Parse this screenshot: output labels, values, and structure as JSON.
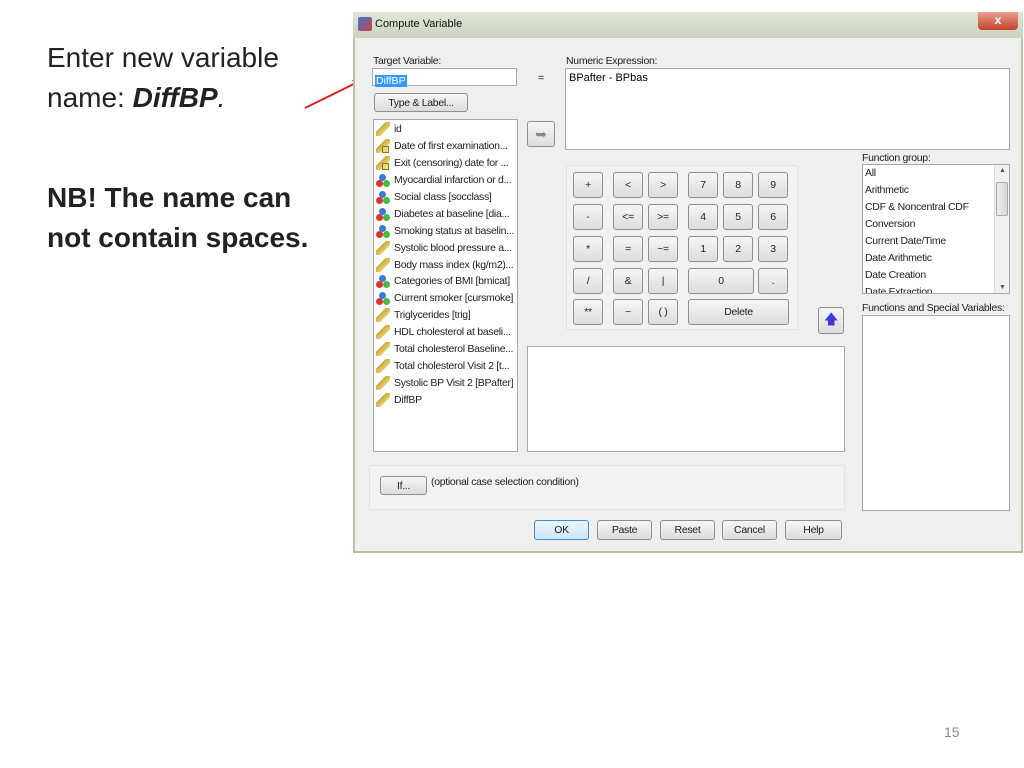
{
  "slide": {
    "line1": "Enter new variable",
    "line2_prefix": "name: ",
    "line2_name": "DiffBP",
    "line2_suffix": ".",
    "nb_line1": "NB! The name can",
    "nb_line2": "not contain spaces.",
    "page_number": "15",
    "arrow_color": "#e02020"
  },
  "dialog": {
    "title": "Compute Variable",
    "close_label": "x",
    "target_label": "Target Variable:",
    "target_value": "DiffBP",
    "equals": "=",
    "type_label_button": "Type & Label...",
    "expression_label": "Numeric Expression:",
    "expression_value": "BPafter - BPbas",
    "variables": [
      {
        "label": "id",
        "icon": "scale-ruler-icon"
      },
      {
        "label": "Date of first examination...",
        "icon": "date-ruler-icon"
      },
      {
        "label": "Exit (censoring) date for ...",
        "icon": "date-ruler-icon"
      },
      {
        "label": "Myocardial infarction or d...",
        "icon": "nominal-icon"
      },
      {
        "label": "Social class [socclass]",
        "icon": "nominal-icon"
      },
      {
        "label": "Diabetes at baseline [dia...",
        "icon": "nominal-icon"
      },
      {
        "label": "Smoking status at baselin...",
        "icon": "nominal-icon"
      },
      {
        "label": "Systolic blood pressure a...",
        "icon": "scale-ruler-icon"
      },
      {
        "label": "Body mass index (kg/m2)...",
        "icon": "scale-ruler-icon"
      },
      {
        "label": "Categories of BMI [bmicat]",
        "icon": "nominal-icon"
      },
      {
        "label": "Current smoker [cursmoke]",
        "icon": "nominal-icon"
      },
      {
        "label": "Triglycerides [trig]",
        "icon": "scale-ruler-icon"
      },
      {
        "label": "HDL cholesterol at baseli...",
        "icon": "scale-ruler-icon"
      },
      {
        "label": "Total cholesterol Baseline...",
        "icon": "scale-ruler-icon"
      },
      {
        "label": "Total cholesterol Visit 2 [t...",
        "icon": "scale-ruler-icon"
      },
      {
        "label": "Systolic BP Visit 2 [BPafter]",
        "icon": "scale-ruler-icon"
      },
      {
        "label": "DiffBP",
        "icon": "scale-ruler-icon"
      }
    ],
    "keypad": [
      "+",
      "<",
      ">",
      "7",
      "8",
      "9",
      "-",
      "<=",
      ">=",
      "4",
      "5",
      "6",
      "*",
      "=",
      "~=",
      "1",
      "2",
      "3",
      "/",
      "&",
      "|",
      "0",
      ".",
      "**",
      "~",
      "( )",
      "Delete"
    ],
    "function_group_label": "Function group:",
    "function_groups": [
      "All",
      "Arithmetic",
      "CDF & Noncentral CDF",
      "Conversion",
      "Current Date/Time",
      "Date Arithmetic",
      "Date Creation",
      "Date Extraction"
    ],
    "functions_label": "Functions and Special Variables:",
    "if_button": "If...",
    "if_text": "(optional case selection condition)",
    "buttons": {
      "ok": "OK",
      "paste": "Paste",
      "reset": "Reset",
      "cancel": "Cancel",
      "help": "Help"
    }
  }
}
